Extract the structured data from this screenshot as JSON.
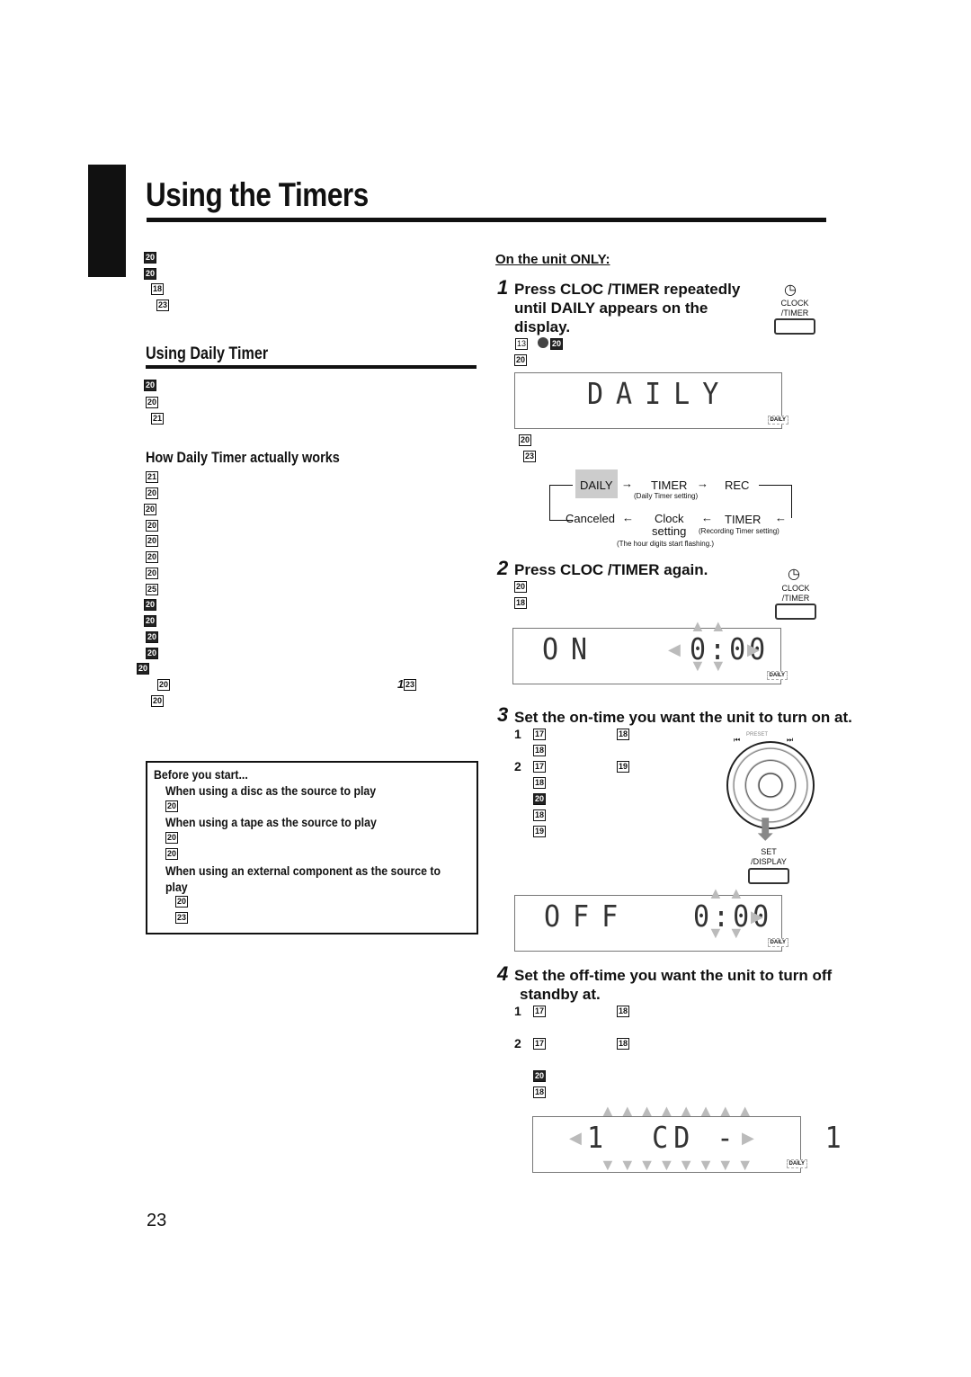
{
  "title": "Using the Timers",
  "left": {
    "intro_glyphs": [
      "20",
      "20",
      "18",
      "23"
    ],
    "section_title": "Using Daily Timer",
    "daily_glyphs": [
      "20",
      "20",
      "21"
    ],
    "subsection_title": "How Daily Timer actually works",
    "works_glyphs": [
      "21",
      "20",
      "20",
      "20",
      "20",
      "20",
      "20",
      "25",
      "20",
      "20",
      "20",
      "20",
      "20",
      "20",
      "20"
    ],
    "ref_glyph": "23",
    "ref_num": "1",
    "before_box": {
      "heading": "Before you start...",
      "disc": "When using a disc as the source to play",
      "tape": "When using a tape as the source to play",
      "external_1": "When using an external component as the source to",
      "external_2": "play",
      "glyphs": [
        "20",
        "20",
        "20",
        "20",
        "23"
      ]
    }
  },
  "right": {
    "unit_only": "On the unit ONLY:",
    "step1": {
      "num": "1",
      "line1": "Press  CLOC  /TIMER repeatedly",
      "line2": "until DAILY appears on the",
      "line3": "display.",
      "glyphs": [
        "13",
        "20",
        "20",
        "20",
        "23"
      ]
    },
    "clock_button": {
      "line1": "CLOCK",
      "line2": "/TIMER"
    },
    "display1": "DAILY",
    "daily_indicator": "DAILY",
    "flow": {
      "daily": "DAILY",
      "timer1": "TIMER",
      "timer1_note": "(Daily Timer setting)",
      "rec": "REC",
      "canceled": "Canceled",
      "clock1": "Clock",
      "clock2": "setting",
      "timer2": "TIMER",
      "timer2_note": "(Recording Timer setting)",
      "note": "(The hour digits start flashing.)",
      "highlight": "#cccccc"
    },
    "step2": {
      "num": "2",
      "text": "Press  CLOC  /TIMER again.",
      "glyphs": [
        "20",
        "18"
      ]
    },
    "display2": {
      "left": "ON",
      "right": "0:00"
    },
    "step3": {
      "num": "3",
      "text": "Set the on-time you want the unit to turn on at.",
      "sub1": "1",
      "sub2": "2",
      "glyphs": [
        "17",
        "18",
        "18",
        "17",
        "19",
        "18",
        "20",
        "18",
        "19"
      ]
    },
    "preset_label": "PRESET",
    "set_button": {
      "line1": "SET",
      "line2": "/DISPLAY"
    },
    "display3": {
      "left": "OFF",
      "right": "0:00"
    },
    "step4": {
      "num": "4",
      "line1": "Set the off-time you want the unit to turn off",
      "line2": "standby  at.",
      "sub1": "1",
      "sub2": "2",
      "glyphs": [
        "17",
        "18",
        "17",
        "18",
        "20",
        "18"
      ]
    },
    "display4": "1  CD --   1"
  },
  "page_number": "23"
}
